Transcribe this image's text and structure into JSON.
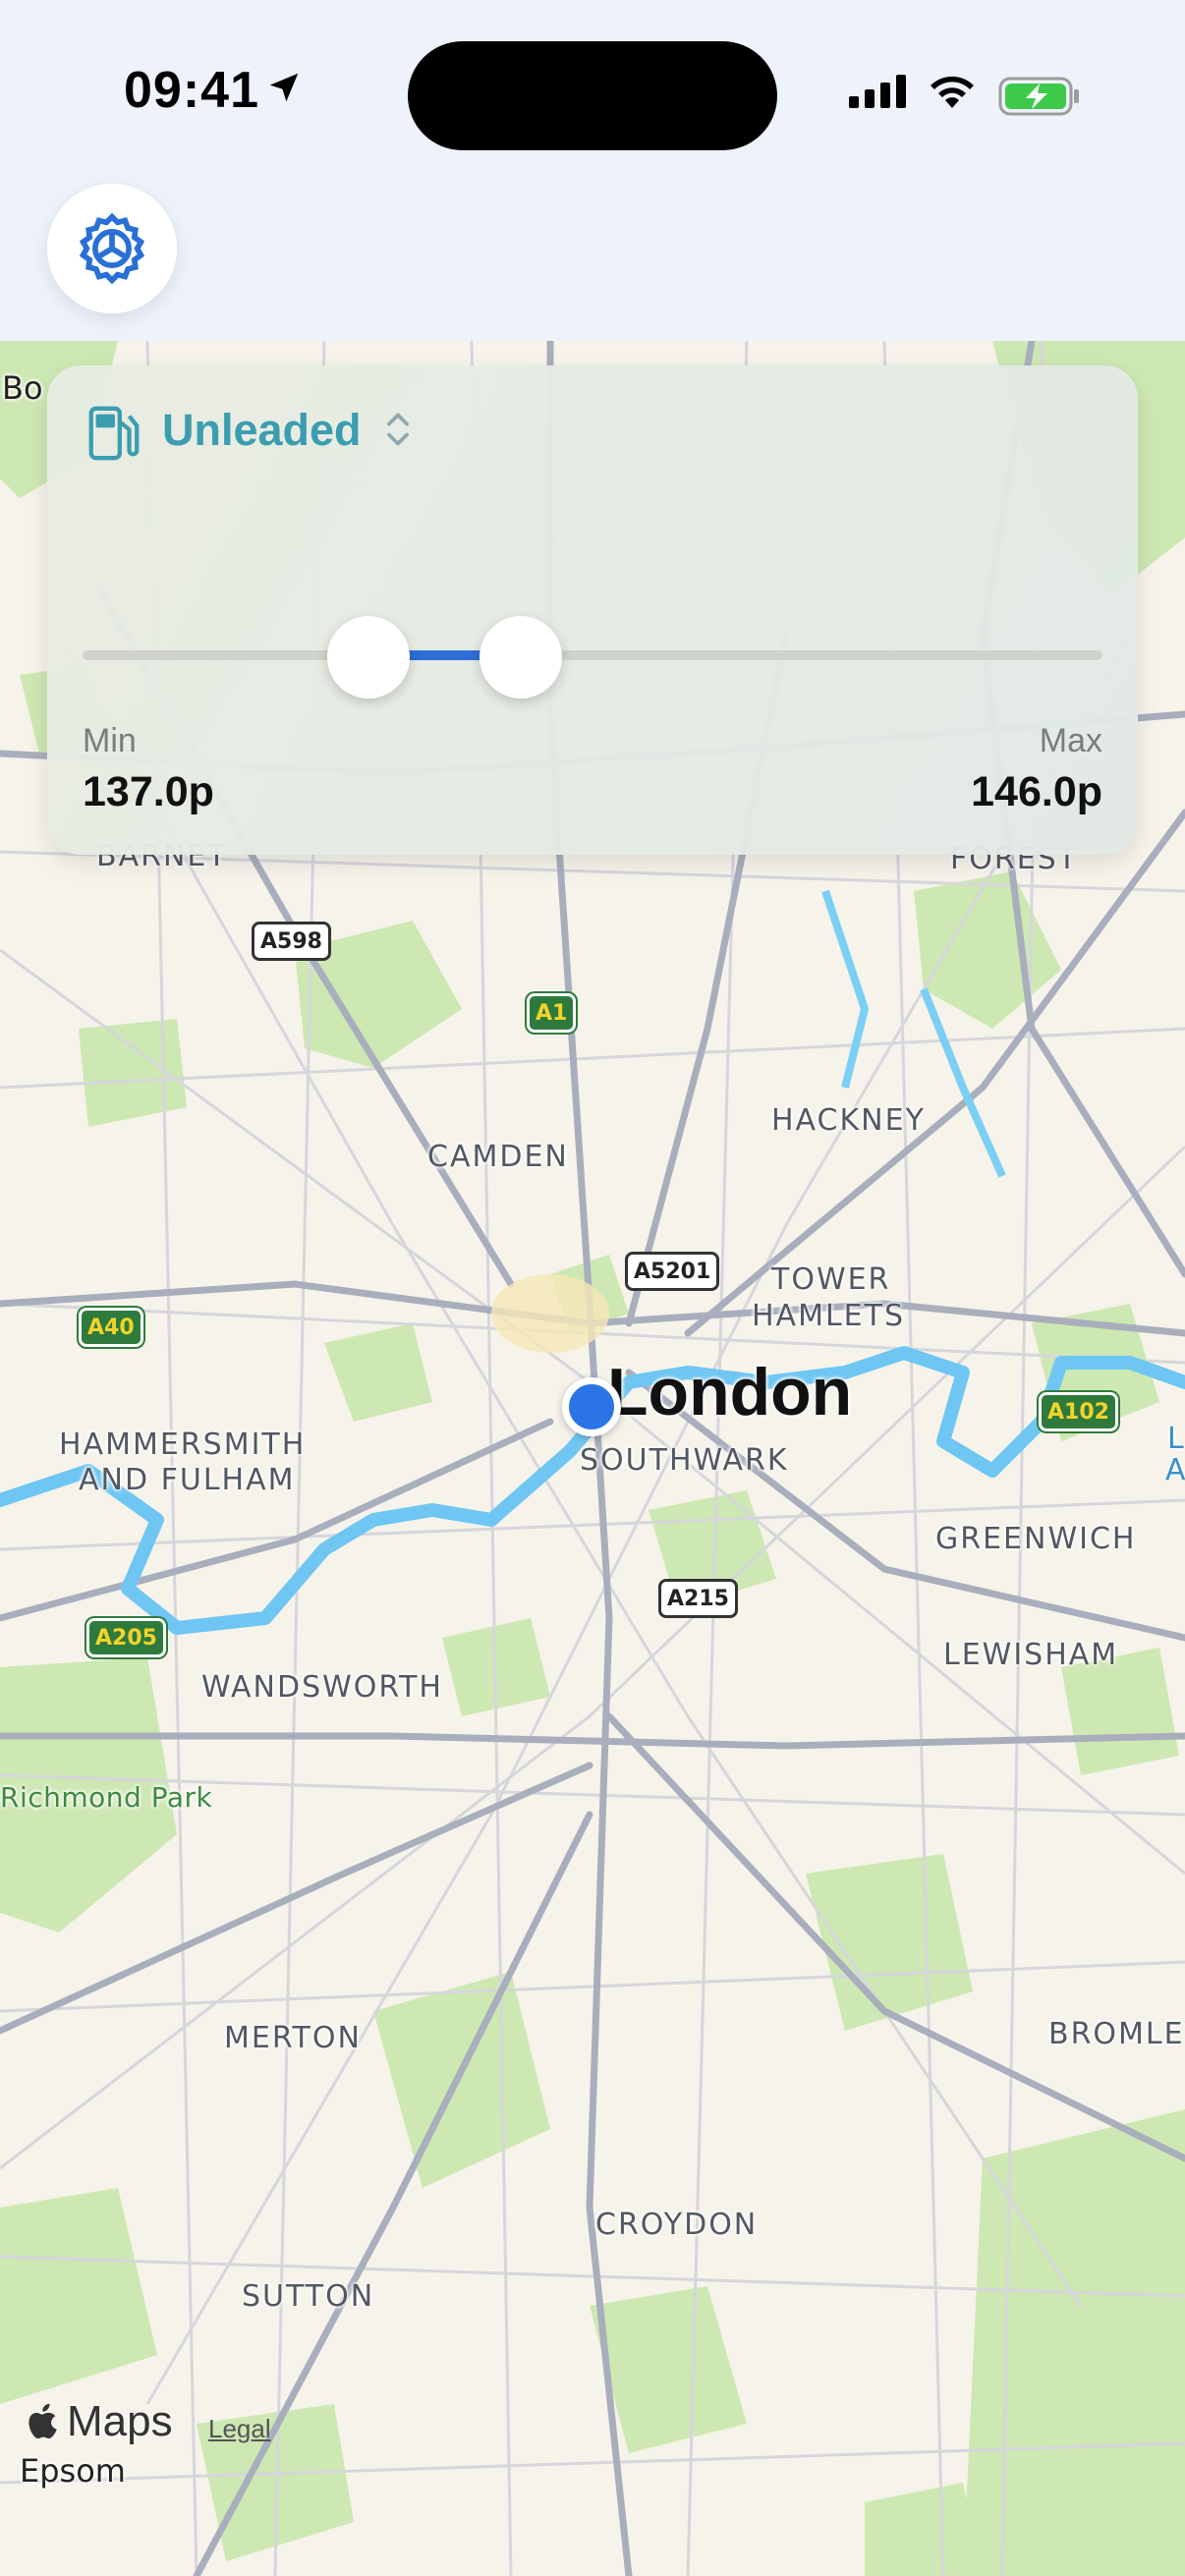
{
  "status_bar": {
    "time": "09:41"
  },
  "filter": {
    "fuel_type": "Unleaded",
    "min_label": "Min",
    "max_label": "Max",
    "min_value": "137.0p",
    "max_value": "146.0p",
    "slider_low_fraction": 0.28,
    "slider_high_fraction": 0.43
  },
  "map": {
    "city": "London",
    "places": [
      "Bo",
      "BARNET",
      "FOREST",
      "CAMDEN",
      "HACKNEY",
      "TOWER",
      "HAMLETS",
      "HAMMERSMITH",
      "AND FULHAM",
      "SOUTHWARK",
      "GREENWICH",
      "LEWISHAM",
      "WANDSWORTH",
      "MERTON",
      "BROMLEY",
      "CROYDON",
      "SUTTON",
      "Epsom",
      "L",
      "A"
    ],
    "park": "Richmond Park",
    "roads": [
      "A598",
      "A1",
      "A5201",
      "A40",
      "A102",
      "A215",
      "A205"
    ],
    "attribution": "Maps",
    "legal": "Legal"
  },
  "colors": {
    "accent": "#2a74e6",
    "fuel_label": "#3b9db0",
    "map_land": "#f6f3ea",
    "park_green": "#cde8b2",
    "water": "#6fc6f2"
  },
  "icons": {
    "settings": "gear-icon",
    "fuel": "fuel-pump-icon",
    "chevron": "chevron-up-down-icon",
    "location": "location-arrow-icon"
  }
}
